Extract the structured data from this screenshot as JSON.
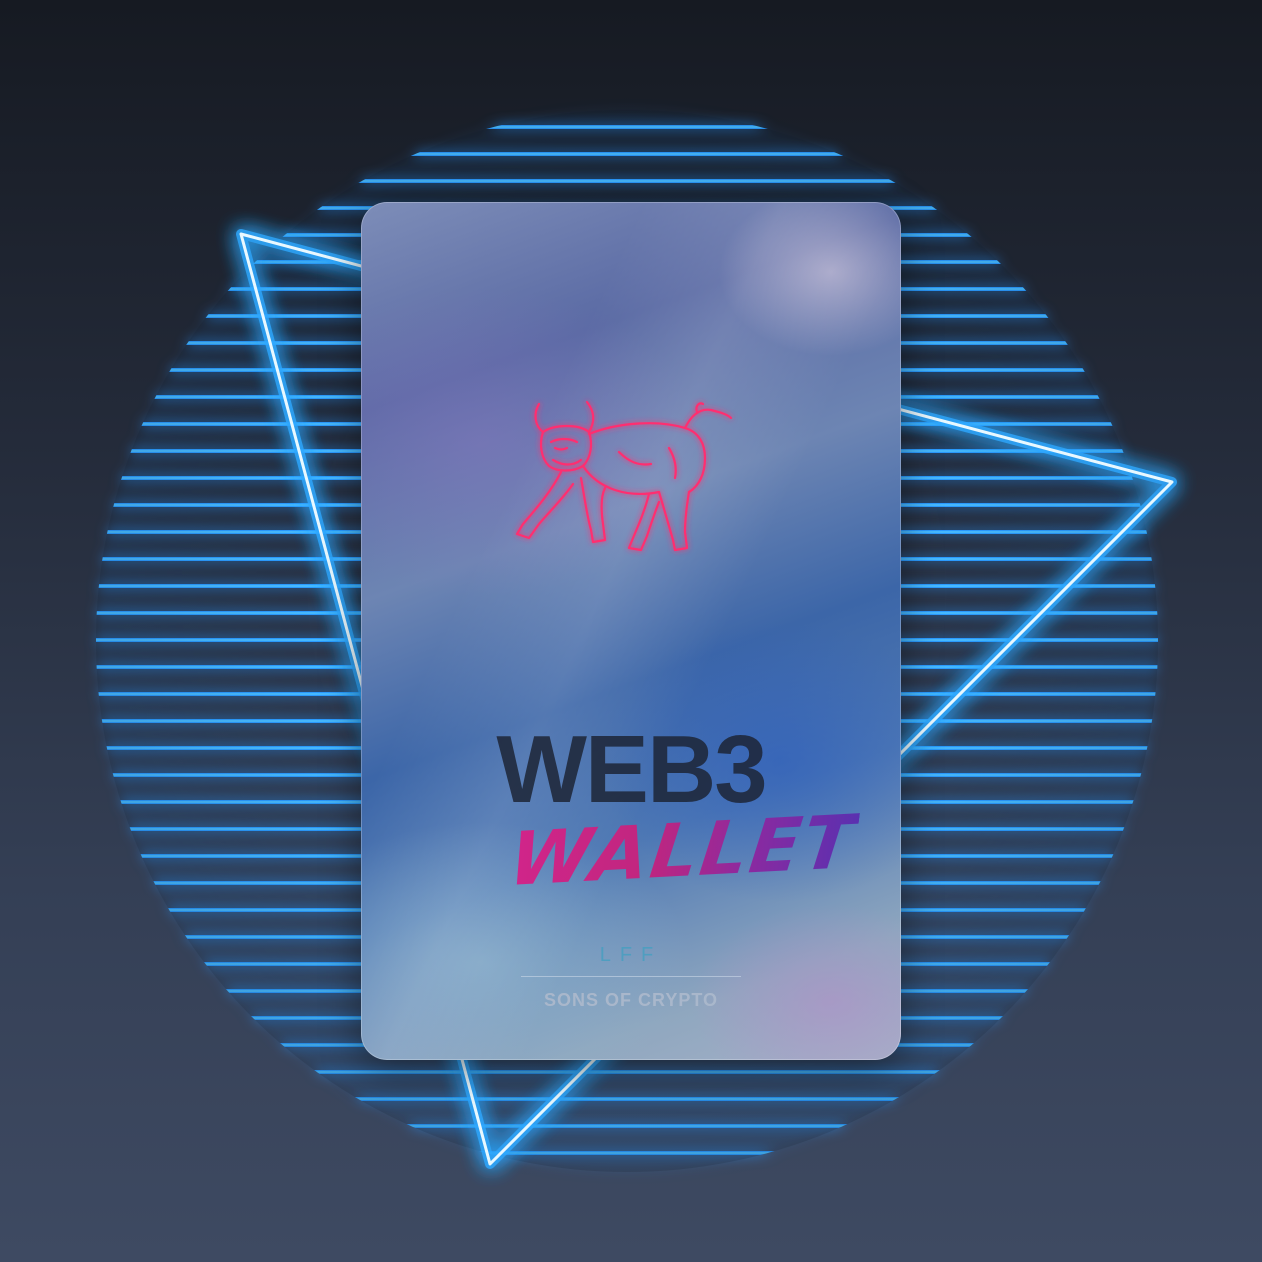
{
  "card": {
    "title_line1": "WEB3",
    "title_line2": "WALLET",
    "tagline": "LFF",
    "brand": "SONS OF CRYPTO"
  },
  "icons": {
    "emblem": "bull-icon",
    "frame": "neon-triangle",
    "backdrop": "striped-circle"
  },
  "colors": {
    "neon_blue": "#3ab4ff",
    "neon_pink": "#ff2d6f",
    "wallet_gradient_start": "#d1258a",
    "wallet_gradient_end": "#5a30b0",
    "web3_text": "#1d2536",
    "background_top": "#161a22",
    "background_bottom": "#3e4a62"
  }
}
